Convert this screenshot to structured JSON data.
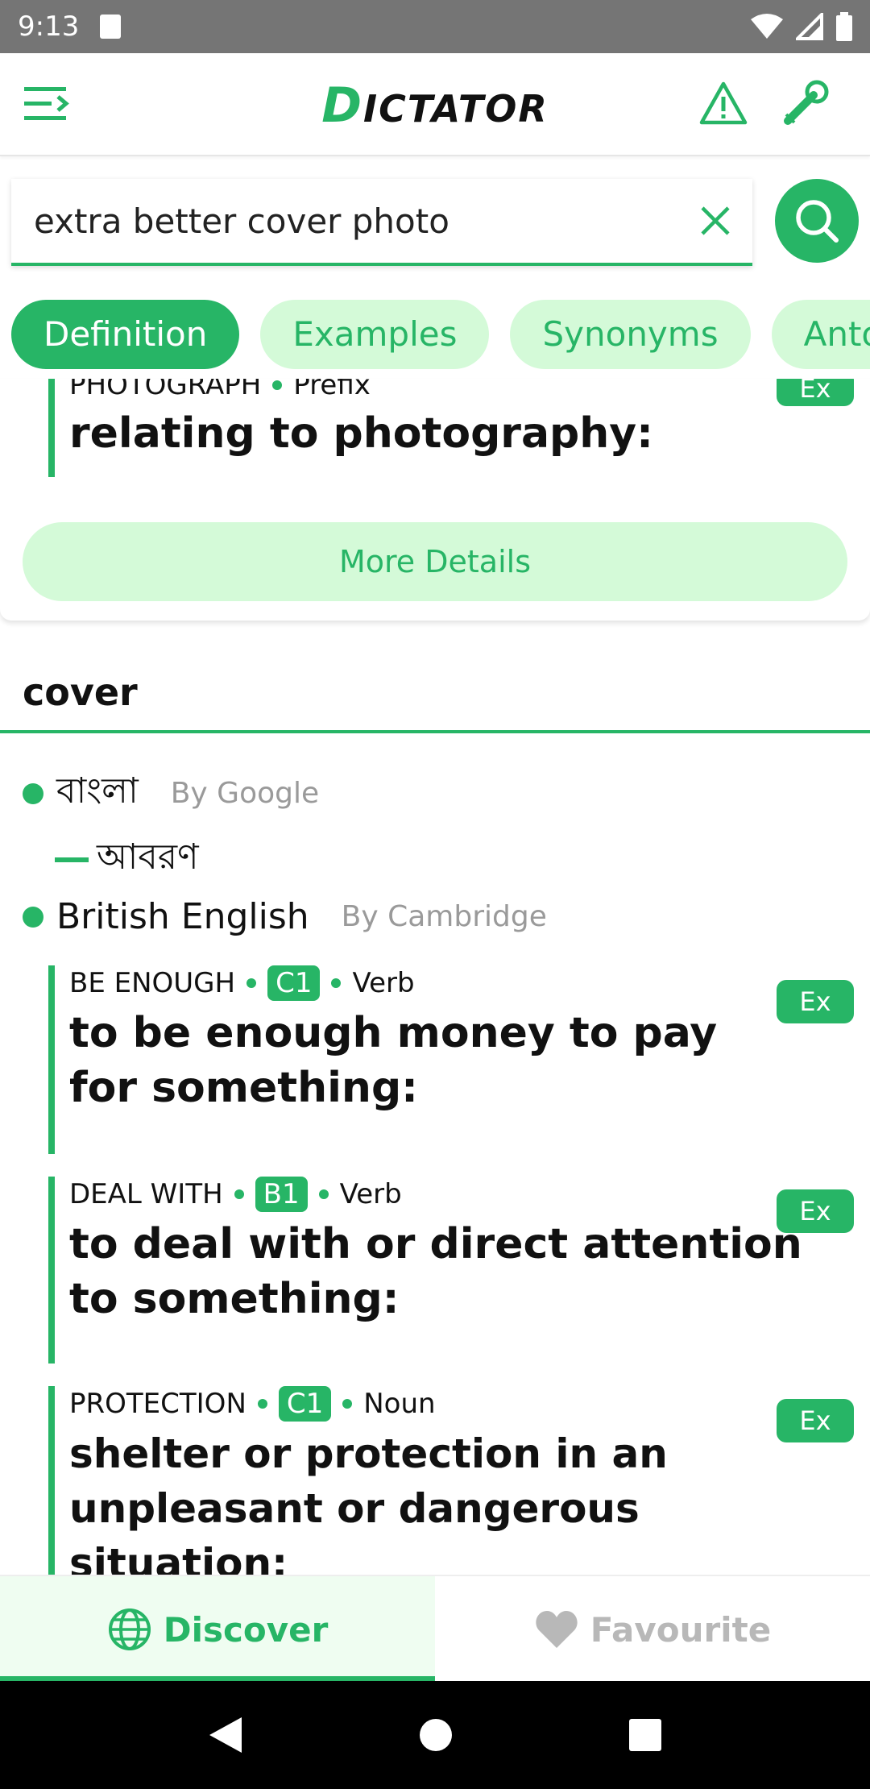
{
  "status_bar": {
    "time": "9:13"
  },
  "app": {
    "title_first": "D",
    "title_rest": "ICTATOR"
  },
  "search": {
    "value": "extra better cover photo"
  },
  "tabs": [
    {
      "label": "Definition",
      "active": true
    },
    {
      "label": "Examples",
      "active": false
    },
    {
      "label": "Synonyms",
      "active": false
    },
    {
      "label": "Antonyms",
      "active": false
    }
  ],
  "top_card": {
    "entry": {
      "guide": "PHOTOGRAPH",
      "pos": "Prefix",
      "definition": "relating to photography:",
      "ex": "Ex"
    },
    "more_details": "More Details"
  },
  "section": {
    "word": "cover",
    "languages": [
      {
        "name": "বাংলা",
        "source": "By Google",
        "translation": "আবরণ"
      },
      {
        "name": "British English",
        "source": "By Cambridge"
      }
    ],
    "definitions": [
      {
        "guide": "BE ENOUGH",
        "level": "C1",
        "pos": "Verb",
        "definition": "to be enough money to pay for something:",
        "ex": "Ex"
      },
      {
        "guide": "DEAL WITH",
        "level": "B1",
        "pos": "Verb",
        "definition": "to deal with or direct attention to something:",
        "ex": "Ex"
      },
      {
        "guide": "PROTECTION",
        "level": "C1",
        "pos": "Noun",
        "definition": "shelter or protection in an unpleasant or dangerous situation:",
        "ex": "Ex"
      }
    ]
  },
  "bottom_nav": {
    "discover": "Discover",
    "favourite": "Favourite"
  },
  "colors": {
    "accent": "#27b566",
    "accent_light": "#d4fad8"
  }
}
